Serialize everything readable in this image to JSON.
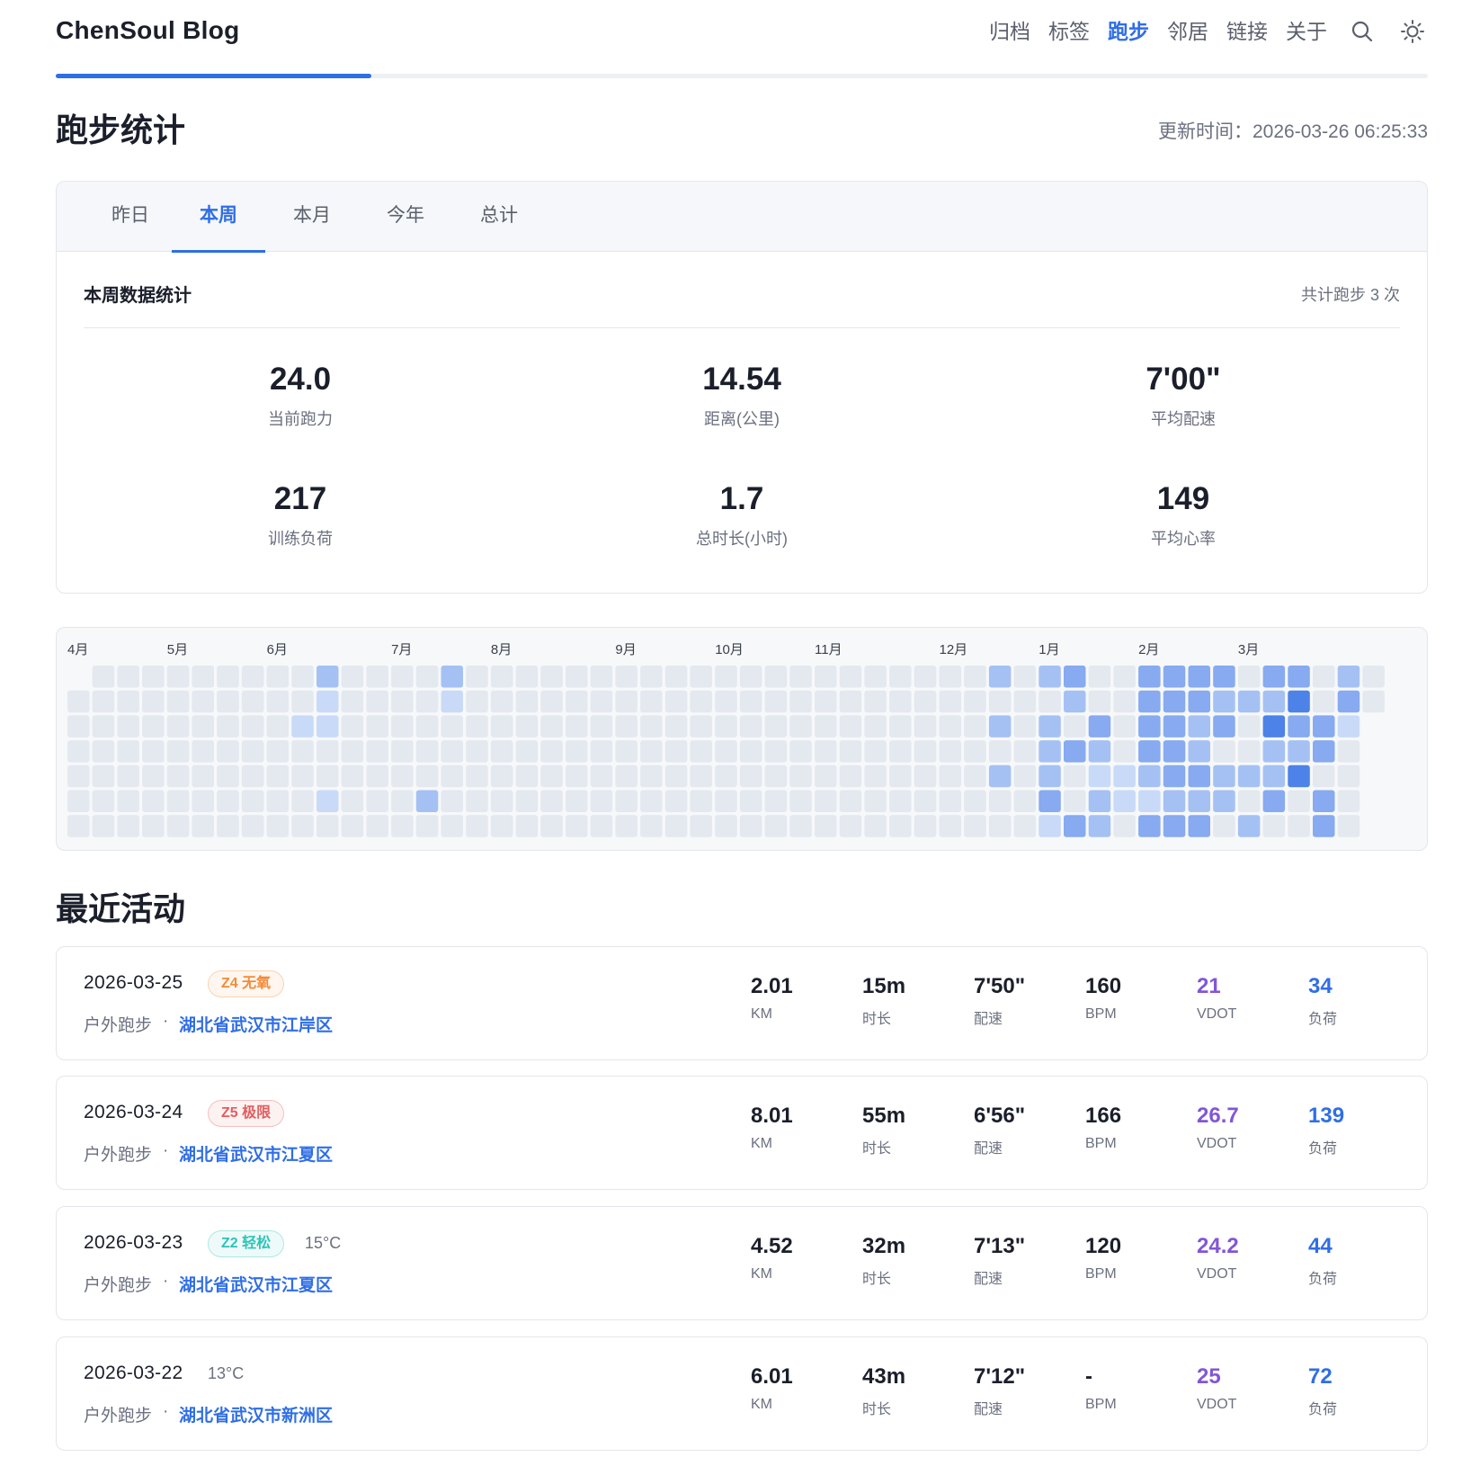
{
  "site": {
    "title": "ChenSoul Blog"
  },
  "nav": {
    "items": [
      {
        "label": "归档",
        "active": false
      },
      {
        "label": "标签",
        "active": false
      },
      {
        "label": "跑步",
        "active": true
      },
      {
        "label": "邻居",
        "active": false
      },
      {
        "label": "链接",
        "active": false
      },
      {
        "label": "关于",
        "active": false
      }
    ],
    "icons": [
      "search-icon",
      "sun-icon"
    ]
  },
  "reading_progress": 0.23,
  "page": {
    "title": "跑步统计",
    "updated_label": "更新时间：",
    "updated_value": "2026-03-26 06:25:33"
  },
  "tabs": [
    "昨日",
    "本周",
    "本月",
    "今年",
    "总计"
  ],
  "active_tab": 1,
  "stats": {
    "title": "本周数据统计",
    "count_text": "共计跑步 3 次",
    "items": [
      {
        "value": "24.0",
        "label": "当前跑力"
      },
      {
        "value": "14.54",
        "label": "距离(公里)"
      },
      {
        "value": "7'00\"",
        "label": "平均配速"
      },
      {
        "value": "217",
        "label": "训练负荷"
      },
      {
        "value": "1.7",
        "label": "总时长(小时)"
      },
      {
        "value": "149",
        "label": "平均心率"
      }
    ]
  },
  "heatmap": {
    "months": [
      "4月",
      "5月",
      "6月",
      "7月",
      "8月",
      "9月",
      "10月",
      "11月",
      "12月",
      "1月",
      "2月",
      "3月"
    ],
    "colors": [
      "#e4e8ef",
      "#c9daf8",
      "#a5c1f4",
      "#87aaf0",
      "#4d82e8"
    ],
    "active_cells": [
      [
        10,
        0,
        2
      ],
      [
        10,
        1,
        1
      ],
      [
        9,
        2,
        1
      ],
      [
        10,
        2,
        1
      ],
      [
        10,
        5,
        1
      ],
      [
        15,
        0,
        2
      ],
      [
        15,
        1,
        1
      ],
      [
        14,
        5,
        2
      ],
      [
        37,
        0,
        2
      ],
      [
        37,
        2,
        2
      ],
      [
        37,
        4,
        2
      ],
      [
        39,
        0,
        2
      ],
      [
        39,
        2,
        2
      ],
      [
        39,
        3,
        2
      ],
      [
        39,
        4,
        2
      ],
      [
        39,
        5,
        3
      ],
      [
        39,
        6,
        1
      ],
      [
        40,
        0,
        3
      ],
      [
        40,
        1,
        2
      ],
      [
        40,
        3,
        3
      ],
      [
        40,
        6,
        3
      ],
      [
        41,
        2,
        3
      ],
      [
        41,
        3,
        2
      ],
      [
        41,
        4,
        1
      ],
      [
        41,
        5,
        2
      ],
      [
        41,
        6,
        2
      ],
      [
        42,
        4,
        1
      ],
      [
        42,
        5,
        1
      ],
      [
        43,
        0,
        3
      ],
      [
        43,
        1,
        3
      ],
      [
        43,
        2,
        3
      ],
      [
        43,
        3,
        3
      ],
      [
        43,
        4,
        2
      ],
      [
        43,
        5,
        1
      ],
      [
        43,
        6,
        3
      ],
      [
        44,
        0,
        3
      ],
      [
        44,
        1,
        3
      ],
      [
        44,
        2,
        3
      ],
      [
        44,
        3,
        3
      ],
      [
        44,
        4,
        3
      ],
      [
        44,
        5,
        2
      ],
      [
        44,
        6,
        3
      ],
      [
        45,
        0,
        3
      ],
      [
        45,
        1,
        3
      ],
      [
        45,
        2,
        2
      ],
      [
        45,
        3,
        2
      ],
      [
        45,
        4,
        3
      ],
      [
        45,
        5,
        2
      ],
      [
        45,
        6,
        3
      ],
      [
        46,
        0,
        3
      ],
      [
        46,
        1,
        2
      ],
      [
        46,
        2,
        3
      ],
      [
        46,
        4,
        2
      ],
      [
        46,
        5,
        2
      ],
      [
        47,
        1,
        2
      ],
      [
        47,
        4,
        2
      ],
      [
        47,
        6,
        2
      ],
      [
        48,
        0,
        3
      ],
      [
        48,
        1,
        2
      ],
      [
        48,
        2,
        4
      ],
      [
        48,
        3,
        2
      ],
      [
        48,
        4,
        2
      ],
      [
        48,
        5,
        3
      ],
      [
        49,
        0,
        3
      ],
      [
        49,
        1,
        4
      ],
      [
        49,
        2,
        3
      ],
      [
        49,
        3,
        2
      ],
      [
        49,
        4,
        4
      ],
      [
        50,
        2,
        3
      ],
      [
        50,
        3,
        3
      ],
      [
        50,
        5,
        3
      ],
      [
        50,
        6,
        3
      ],
      [
        51,
        0,
        2
      ],
      [
        51,
        1,
        3
      ],
      [
        51,
        2,
        1
      ]
    ]
  },
  "recent": {
    "title": "最近活动",
    "activities": [
      {
        "date": "2026-03-25",
        "badge": "Z4 无氧",
        "badge_color": "#f28c38",
        "temp": "",
        "type": "户外跑步",
        "location": "湖北省武汉市江岸区",
        "km": "2.01",
        "time": "15m",
        "pace": "7'50\"",
        "bpm": "160",
        "vdot": "21",
        "load": "34"
      },
      {
        "date": "2026-03-24",
        "badge": "Z5 极限",
        "badge_color": "#e35d5d",
        "temp": "",
        "type": "户外跑步",
        "location": "湖北省武汉市江夏区",
        "km": "8.01",
        "time": "55m",
        "pace": "6'56\"",
        "bpm": "166",
        "vdot": "26.7",
        "load": "139"
      },
      {
        "date": "2026-03-23",
        "badge": "Z2 轻松",
        "badge_color": "#2cc4b8",
        "temp": "15°C",
        "type": "户外跑步",
        "location": "湖北省武汉市江夏区",
        "km": "4.52",
        "time": "32m",
        "pace": "7'13\"",
        "bpm": "120",
        "vdot": "24.2",
        "load": "44"
      },
      {
        "date": "2026-03-22",
        "badge": "",
        "badge_color": "",
        "temp": "13°C",
        "type": "户外跑步",
        "location": "湖北省武汉市新洲区",
        "km": "6.01",
        "time": "43m",
        "pace": "7'12\"",
        "bpm": "-",
        "vdot": "25",
        "load": "72"
      }
    ],
    "labels": {
      "km": "KM",
      "time": "时长",
      "pace": "配速",
      "bpm": "BPM",
      "vdot": "VDOT",
      "load": "负荷"
    },
    "separator": "·"
  }
}
